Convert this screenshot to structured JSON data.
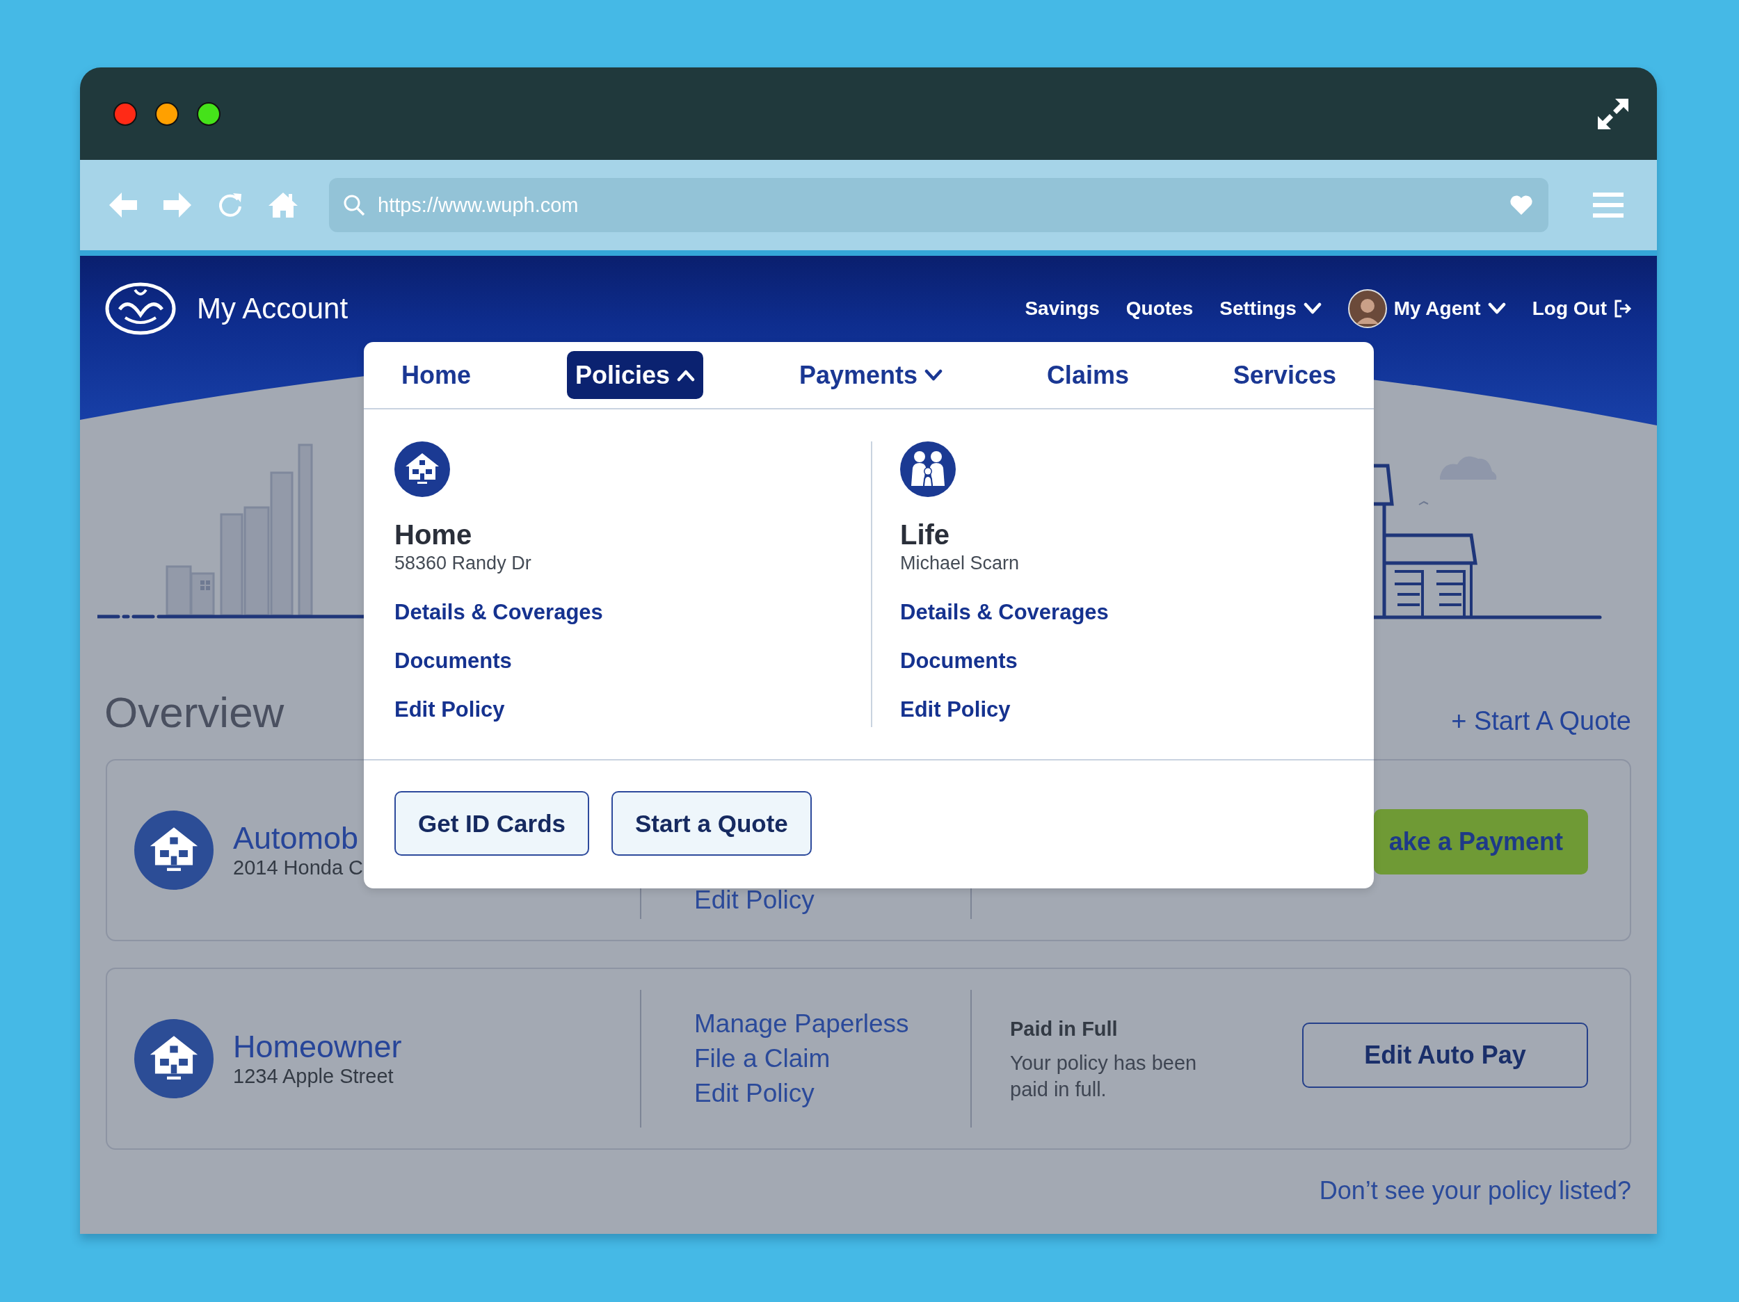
{
  "browser": {
    "url": "https://www.wuph.com"
  },
  "header": {
    "title": "My Account",
    "nav": [
      {
        "label": "Savings",
        "kind": "link"
      },
      {
        "label": "Quotes",
        "kind": "link"
      },
      {
        "label": "Settings",
        "kind": "dropdown"
      },
      {
        "label": "My Agent",
        "kind": "agent"
      },
      {
        "label": "Log Out",
        "kind": "logout"
      }
    ]
  },
  "menu": {
    "tabs": [
      {
        "label": "Home",
        "selected": false,
        "kind": "link"
      },
      {
        "label": "Policies",
        "selected": true,
        "kind": "dropdown",
        "expanded": true
      },
      {
        "label": "Payments",
        "selected": false,
        "kind": "dropdown",
        "expanded": false
      },
      {
        "label": "Claims",
        "selected": false,
        "kind": "link"
      },
      {
        "label": "Services",
        "selected": false,
        "kind": "link"
      }
    ],
    "policies": [
      {
        "kind": "home",
        "title": "Home",
        "subtitle": "58360 Randy Dr",
        "links": [
          "Details & Coverages",
          "Documents",
          "Edit Policy"
        ]
      },
      {
        "kind": "life",
        "title": "Life",
        "subtitle": "Michael Scarn",
        "links": [
          "Details & Coverages",
          "Documents",
          "Edit Policy"
        ]
      }
    ],
    "buttons": [
      "Get ID Cards",
      "Start a Quote"
    ]
  },
  "overview": {
    "title": "Overview",
    "action": "+ Start A Quote",
    "cards": [
      {
        "title": "Automob",
        "subtitle": "2014 Honda C",
        "links": [
          "Edit Policy"
        ],
        "button": {
          "label": "ake a Payment",
          "kind": "primary"
        }
      },
      {
        "title": "Homeowner",
        "subtitle": "1234 Apple Street",
        "links": [
          "Manage Paperless",
          "File a Claim",
          "Edit Policy"
        ],
        "status": {
          "title": "Paid in Full",
          "text": "Your policy has been paid in full."
        },
        "button": {
          "label": "Edit Auto Pay",
          "kind": "outline"
        }
      }
    ],
    "footer_link": "Don’t see your policy listed?"
  }
}
